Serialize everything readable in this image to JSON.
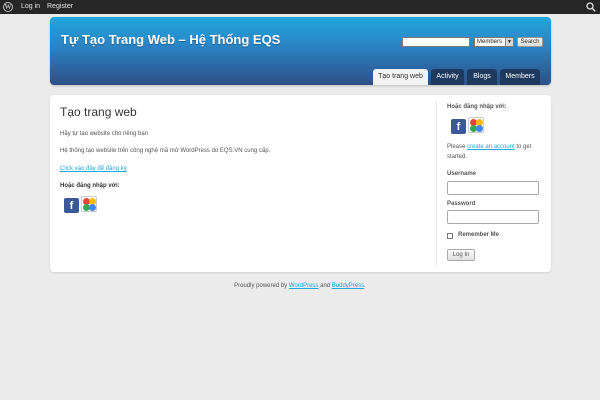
{
  "admin_bar": {
    "logo_icon": "wordpress-icon",
    "login_label": "Log in",
    "register_label": "Register",
    "search_icon": "search-icon"
  },
  "header": {
    "site_title": "Tự Tạo Trang Web – Hệ Thống EQS",
    "search": {
      "value": "",
      "scope": "Members",
      "button": "Search"
    },
    "nav": [
      {
        "label": "Tạo trang web",
        "active": true
      },
      {
        "label": "Activity",
        "active": false
      },
      {
        "label": "Blogs",
        "active": false
      },
      {
        "label": "Members",
        "active": false
      }
    ]
  },
  "content": {
    "title": "Tạo trang web",
    "para1": "Hãy tự tạo website cho riêng bạn",
    "para2": "Hệ thống tạo website trên công nghệ mã mở WordPress do EQS.VN cung cấp.",
    "register_link": "Click vào đây để đăng ký",
    "social_label": "Hoặc đăng nhập với:",
    "social_icons": [
      "facebook-icon",
      "google-icon"
    ]
  },
  "sidebar": {
    "social_label": "Hoặc đăng nhập với:",
    "prompt_before": "Please ",
    "prompt_link": "create an account",
    "prompt_after": " to get",
    "prompt_line2": "started.",
    "username_label": "Username",
    "username_value": "",
    "password_label": "Password",
    "password_value": "",
    "remember_label": "Remember Me",
    "remember_checked": false,
    "login_button": "Log In"
  },
  "footer": {
    "before": "Proudly powered by ",
    "link1": "WordPress",
    "middle": " and ",
    "link2": "BuddyPress",
    "after": "."
  },
  "colors": {
    "header_top": "#21a6de",
    "header_bottom": "#2e4f86",
    "nav_tab": "#1e3a5f",
    "link": "#1fa8d8",
    "admin_bar": "#262626"
  }
}
